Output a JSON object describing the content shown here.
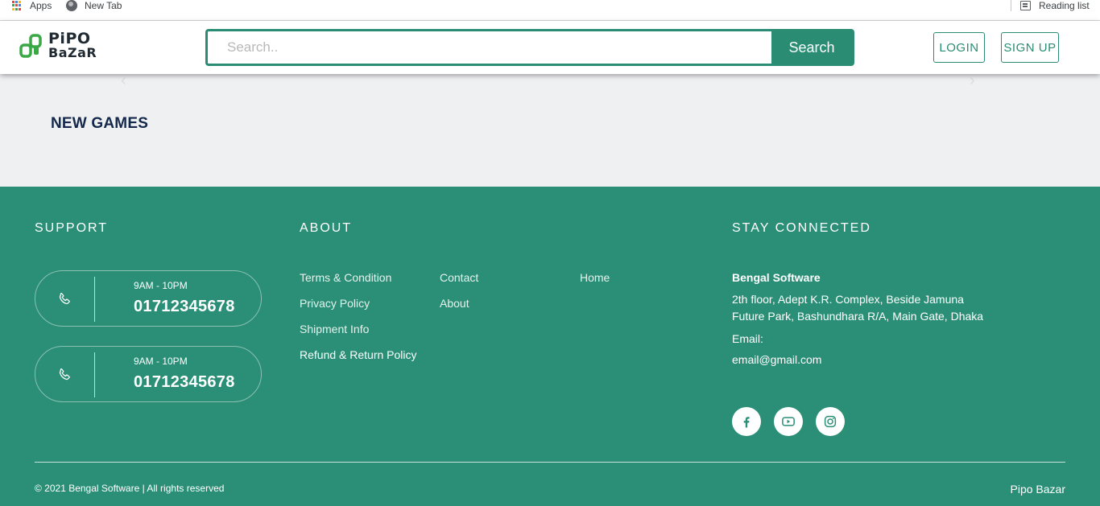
{
  "bookmarks": {
    "apps_label": "Apps",
    "newtab_label": "New Tab",
    "reading_list_label": "Reading list"
  },
  "header": {
    "logo_line1": "PiPO",
    "logo_line2": "BaZaR",
    "search_placeholder": "Search..",
    "search_value": "",
    "search_button": "Search",
    "login_button": "LOGIN",
    "signup_button": "SIGN UP"
  },
  "carousel": {
    "prev_glyph": "‹",
    "next_glyph": "›"
  },
  "main": {
    "section_title": "NEW GAMES"
  },
  "footer": {
    "support_title": "SUPPORT",
    "about_title": "ABOUT",
    "connected_title": "STAY CONNECTED",
    "support_cards": [
      {
        "hours": "9AM - 10PM",
        "phone": "01712345678"
      },
      {
        "hours": "9AM - 10PM",
        "phone": "01712345678"
      }
    ],
    "about_links": {
      "terms": "Terms & Condition",
      "privacy": "Privacy Policy",
      "shipment": "Shipment Info",
      "refund": "Refund & Return Policy",
      "contact": "Contact",
      "about": "About",
      "home": "Home"
    },
    "company_name": "Bengal Software",
    "address": "2th floor, Adept K.R. Complex, Beside Jamuna Future Park, Bashundhara R/A, Main Gate, Dhaka",
    "email_label": "Email:",
    "email": "email@gmail.com",
    "social": [
      "facebook-icon",
      "youtube-icon",
      "instagram-icon"
    ],
    "copyright": "© 2021 Bengal Software | All rights reserved",
    "brand": "Pipo Bazar"
  },
  "colors": {
    "brand_green": "#2a8f76",
    "title_navy": "#14284b",
    "page_bg": "#eff0f2"
  }
}
